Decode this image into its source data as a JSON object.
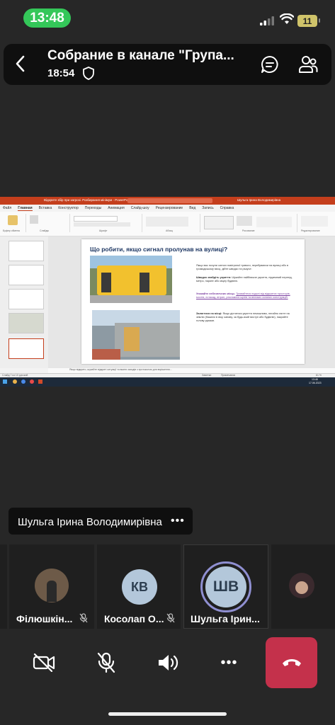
{
  "status_bar": {
    "time": "13:48",
    "battery": "11"
  },
  "header": {
    "title": "Собрание в канале \"Група...",
    "elapsed": "18:54"
  },
  "shared_screen": {
    "window_title": "Відкрите збір при загрозі. Розбирання мінімум - PowerPoint",
    "search_placeholder": "Пошук",
    "user_name": "Шульга Ірина Володимирівна",
    "ribbon_tabs": [
      "Файл",
      "Главная",
      "Вставка",
      "Конструктор",
      "Переходы",
      "Анимация",
      "Слайд-шоу",
      "Рецензирование",
      "Вид",
      "Запись",
      "Справка"
    ],
    "ribbon_groups": [
      "Буфер обмена",
      "Слайды",
      "Шрифт",
      "Абзац",
      "Рисование",
      "Редактирование"
    ],
    "slide_title": "Що робити, якщо сигнал пролунав на вулиці?",
    "slide_intro": "Якщо вас почули сигнал повітряної тривоги, перебуваючи на вулиці або в громадському місці, дійте швидко та рішуче:",
    "bullets": [
      {
        "head": "Швидко знайдіть укриття:",
        "body": "Шукайте найближче укриття, підземний перехід, метро, паркінг або міцну будівлю."
      },
      {
        "head": "Уникайте небезпечних місць:",
        "body": "Тримайтеся подалі від відкритих просторів, мостів, естакад, вітрин, рекламних щитів та великих скляних конструкцій."
      },
      {
        "head": "Залягтися на місці:",
        "body": "Якщо дістатися укриття неможливо, негайно лягте на землю (бажано в яму, канаву, за будь-який виступ або будівлю), накрийте голову руками."
      }
    ],
    "notes": "Якщо відкрито, шукайте відкриті ситуації та вжити заходів з протоколом для вирішення...",
    "status_left": "Слайд 7 из 10    русский",
    "status_notes": "Заметки",
    "status_comments": "Примечания",
    "zoom": "61 %",
    "taskbar_time": "13:48",
    "taskbar_date": "17.06.2023"
  },
  "active_speaker": {
    "name": "Шульга Ірина Володимирівна"
  },
  "participants": [
    {
      "name": "Філюшкін...",
      "initials": "",
      "muted": true
    },
    {
      "name": "Косолап О...",
      "initials": "КВ",
      "muted": true
    },
    {
      "name": "Шульга Ірин...",
      "initials": "ШВ",
      "muted": false
    },
    {
      "name": "",
      "initials": "",
      "muted": false
    }
  ],
  "colors": {
    "accent": "#34c759",
    "hangup": "#c4314b",
    "speaker_ring": "#8f8fd1",
    "avatar_bg": "#b3c7da"
  }
}
